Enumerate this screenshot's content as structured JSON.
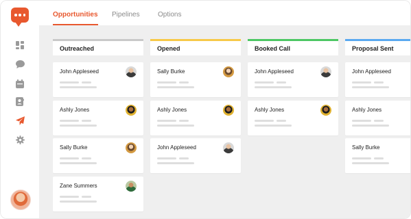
{
  "tabs": [
    {
      "label": "Opportunities",
      "active": true
    },
    {
      "label": "Pipelines",
      "active": false
    },
    {
      "label": "Options",
      "active": false
    }
  ],
  "sidebar": {
    "icons": [
      "dashboard-icon",
      "chat-icon",
      "calendar-icon",
      "contacts-icon",
      "send-icon",
      "settings-icon"
    ],
    "active_icon": "send-icon"
  },
  "accent_color": "#e8582e",
  "columns": [
    {
      "title": "Outreached",
      "color": "#c9c9c9",
      "cards": [
        "John Appleseed",
        "Ashly Jones",
        "Sally Burke",
        "Zane Summers"
      ]
    },
    {
      "title": "Opened",
      "color": "#f7c948",
      "cards": [
        "Sally Burke",
        "Ashly Jones",
        "John Appleseed"
      ]
    },
    {
      "title": "Booked Call",
      "color": "#4cc764",
      "cards": [
        "John Appleseed",
        "Ashly Jones"
      ]
    },
    {
      "title": "Proposal Sent",
      "color": "#5aa9f0",
      "cards": [
        "John Appleseed",
        "Ashly Jones",
        "Sally Burke"
      ]
    }
  ]
}
